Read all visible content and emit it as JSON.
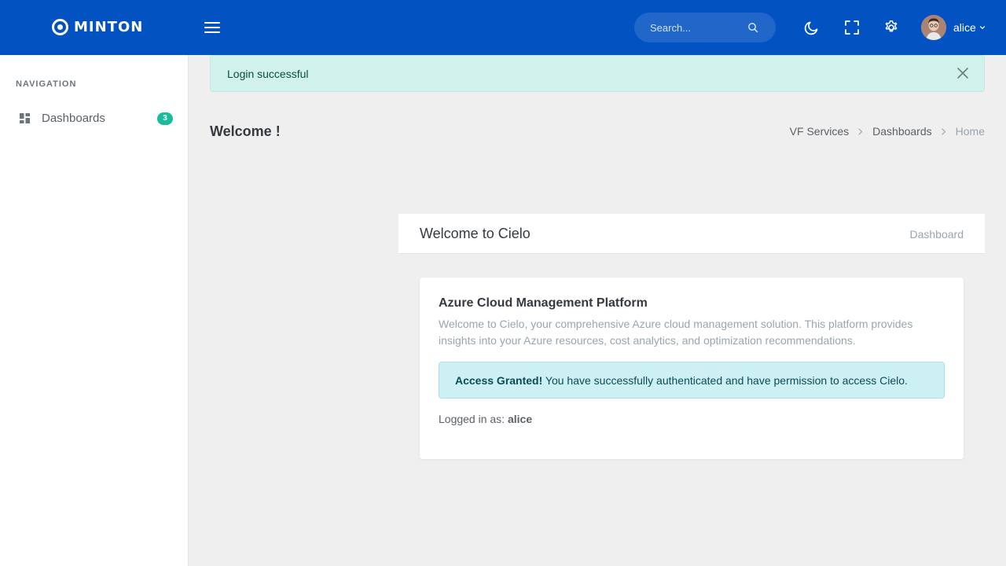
{
  "topbar": {
    "brand": "MINTON",
    "search_placeholder": "Search...",
    "user": {
      "name": "alice"
    }
  },
  "sidebar": {
    "section_title": "NAVIGATION",
    "items": [
      {
        "label": "Dashboards",
        "badge": "3"
      }
    ]
  },
  "alert": {
    "message": "Login successful"
  },
  "page": {
    "title": "Welcome !",
    "breadcrumb": [
      "VF Services",
      "Dashboards",
      "Home"
    ]
  },
  "welcome": {
    "title": "Welcome to Cielo",
    "subtitle": "Dashboard"
  },
  "card": {
    "title": "Azure Cloud Management Platform",
    "description": "Welcome to Cielo, your comprehensive Azure cloud management solution. This platform provides insights into your Azure resources, cost analytics, and optimization recommendations.",
    "access_strong": "Access Granted!",
    "access_text": " You have successfully authenticated and have permission to access Cielo.",
    "logged_in_label": "Logged in as: ",
    "logged_in_user": "alice"
  },
  "colors": {
    "topbar": "#0352c2",
    "badge": "#1abc9c",
    "alert_success_bg": "#d1f2eb",
    "alert_info_bg": "#cdf0f4"
  }
}
